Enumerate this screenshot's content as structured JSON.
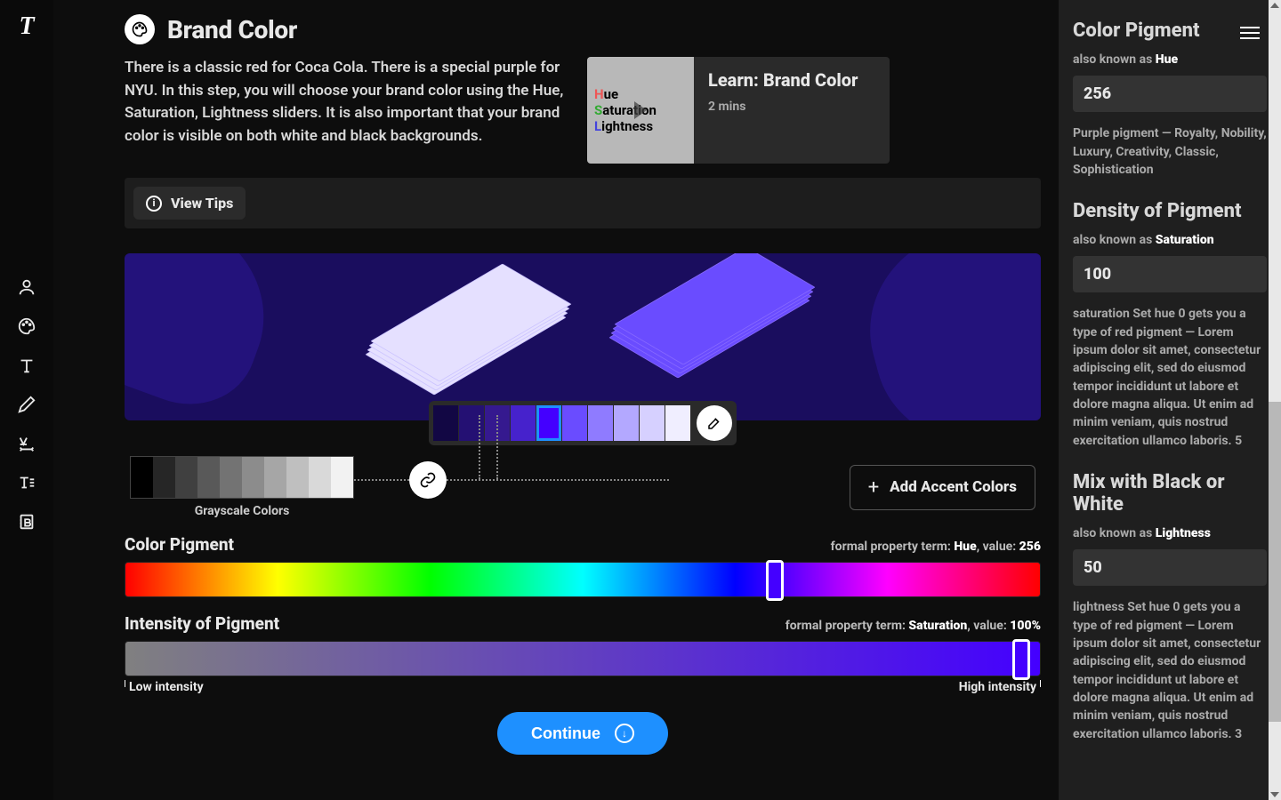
{
  "brand": {
    "logo": "T"
  },
  "page": {
    "title": "Brand Color",
    "intro": "There is a classic red for Coca Cola. There is a special purple for NYU. In this step, you will choose your brand color using the Hue, Saturation, Lightness sliders. It is also important that your brand color is visible on both white and black backgrounds."
  },
  "video": {
    "title": "Learn: Brand Color",
    "duration": "2 mins",
    "thumb_hue_h": "H",
    "thumb_hue_rest": "ue",
    "thumb_sat_s": "S",
    "thumb_sat_rest": "aturation",
    "thumb_lig_l": "L",
    "thumb_lig_rest": "ightness"
  },
  "tips": {
    "button": "View Tips"
  },
  "palette": {
    "colors": [
      "#120744",
      "#241073",
      "#35198f",
      "#4622cc",
      "#4400ff",
      "#6a4cff",
      "#8f7bff",
      "#b3a8ff",
      "#d6d0ff",
      "#f0eeff"
    ],
    "selected_index": 4
  },
  "grayscale": {
    "label": "Grayscale Colors",
    "colors": [
      "#000000",
      "#262626",
      "#404040",
      "#595959",
      "#737373",
      "#8c8c8c",
      "#a6a6a6",
      "#bfbfbf",
      "#d9d9d9",
      "#f2f2f2"
    ]
  },
  "accent": {
    "add_label": "Add Accent Colors"
  },
  "sliders": {
    "hue": {
      "label": "Color Pigment",
      "meta_prefix": "formal property term: ",
      "meta_term": "Hue",
      "meta_value_prefix": ", value: ",
      "value": "256",
      "thumb_pct": 71
    },
    "sat": {
      "label": "Intensity of Pigment",
      "meta_prefix": "formal property term: ",
      "meta_term": "Saturation",
      "meta_value_prefix": ", value: ",
      "value": "100%",
      "thumb_pct": 98,
      "low": "Low intensity",
      "high": "High intensity"
    }
  },
  "continue": {
    "label": "Continue"
  },
  "side": {
    "hue": {
      "title": "Color Pigment",
      "aka_prefix": "also known as ",
      "aka_term": "Hue",
      "value": "256",
      "desc": "Purple pigment — Royalty, Nobility, Luxury, Creativity, Classic, Sophistication"
    },
    "sat": {
      "title": "Density of Pigment",
      "aka_prefix": "also known as ",
      "aka_term": "Saturation",
      "value": "100",
      "desc": "saturation Set hue 0 gets you a type of red pigment — Lorem ipsum dolor sit amet, consectetur adipiscing elit, sed do eiusmod tempor incididunt ut labore et dolore magna aliqua. Ut enim ad minim veniam, quis nostrud exercitation ullamco laboris. 5"
    },
    "lig": {
      "title": "Mix with Black or White",
      "aka_prefix": "also known as ",
      "aka_term": "Lightness",
      "value": "50",
      "desc": "lightness Set hue 0 gets you a type of red pigment — Lorem ipsum dolor sit amet, consectetur adipiscing elit, sed do eiusmod tempor incididunt ut labore et dolore magna aliqua. Ut enim ad minim veniam, quis nostrud exercitation ullamco laboris. 3"
    }
  }
}
